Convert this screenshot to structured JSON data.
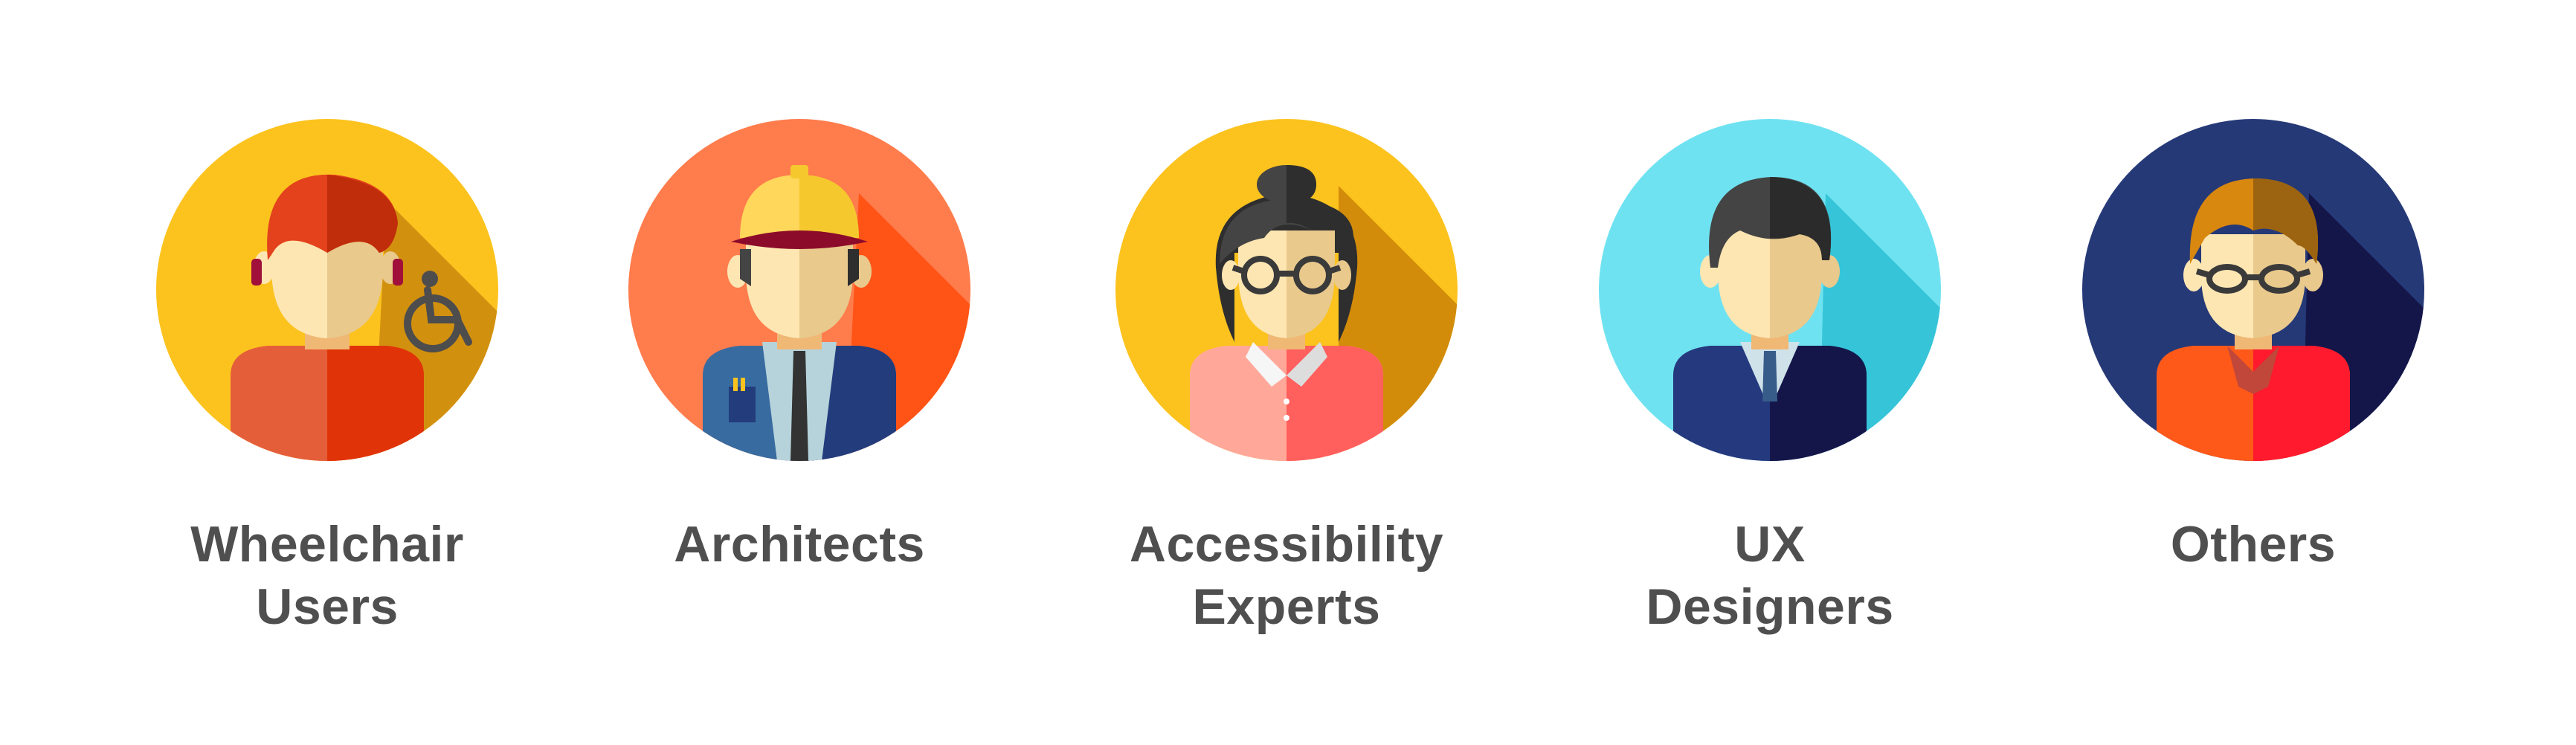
{
  "personas": [
    {
      "label_lines": [
        "Wheelchair",
        "Users"
      ],
      "icon": "wheelchair-user-avatar-icon",
      "colors": {
        "bg": "#fcc31e",
        "shadow": "#d2900f",
        "hair": "#e3421c",
        "hair_dark": "#c02d0a",
        "shirt": "#e55e3a",
        "shirt_dark": "#e03408",
        "accent": "#a0103a",
        "badge": "#4d4d4d"
      }
    },
    {
      "label_lines": [
        "Architects"
      ],
      "icon": "architect-avatar-icon",
      "colors": {
        "bg": "#ff7c4c",
        "shadow": "#ff5416",
        "helmet": "#ffd75a",
        "helmet_dark": "#f5c92e",
        "band": "#8c0b2a",
        "hair": "#444444",
        "suit": "#386b9f",
        "suit_dark": "#233c7c",
        "shirt": "#b6d3db",
        "tie": "#333333"
      }
    },
    {
      "label_lines": [
        "Accessibility",
        "Experts"
      ],
      "icon": "accessibility-expert-avatar-icon",
      "colors": {
        "bg": "#fcc31e",
        "shadow": "#d38c0a",
        "hair": "#444444",
        "hair_dark": "#2e2e2e",
        "blouse": "#ffa89a",
        "blouse_dark": "#ff5f5d",
        "collar": "#f6f6f6",
        "glasses": "#3a3a3a"
      }
    },
    {
      "label_lines": [
        "UX",
        "Designers"
      ],
      "icon": "ux-designer-avatar-icon",
      "colors": {
        "bg": "#6fe2f1",
        "shadow": "#36c4d8",
        "hair": "#444444",
        "hair_dark": "#2b2b2b",
        "suit": "#25397e",
        "suit_dark": "#141649",
        "shirt": "#cfe2ea",
        "tie": "#385c8a"
      }
    },
    {
      "label_lines": [
        "Others"
      ],
      "icon": "other-person-avatar-icon",
      "colors": {
        "bg": "#263977",
        "shadow": "#141649",
        "hair": "#d8870f",
        "hair_dark": "#9c6410",
        "shirt": "#ff5919",
        "shirt_dark": "#ff1a2d",
        "collar": "#c0473a",
        "glasses": "#3a3a3a"
      }
    }
  ],
  "skin": {
    "light": "#fde6b2",
    "dark": "#e9c98c",
    "neck": "#f0b875"
  }
}
